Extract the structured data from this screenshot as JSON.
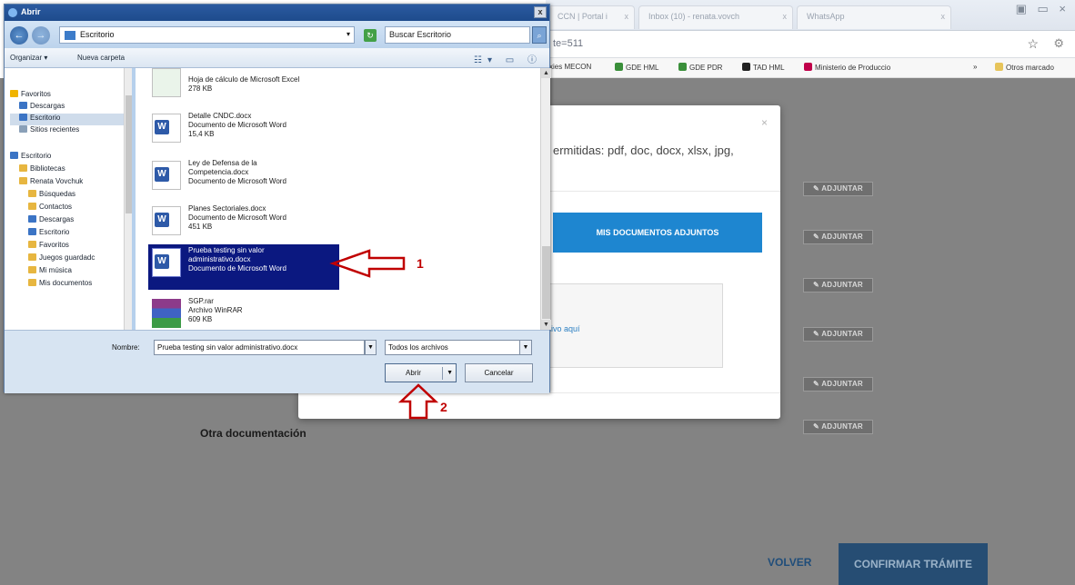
{
  "browser": {
    "tabs": [
      {
        "label": "CCN | Portal i",
        "close": "x"
      },
      {
        "label": "Inbox (10) - renata.vovch",
        "close": "x"
      },
      {
        "label": "WhatsApp",
        "close": "x"
      }
    ],
    "window_buttons": "▣ ▭ ×",
    "url": "te=511",
    "bookmarks": [
      {
        "label": "xies MECON",
        "color": "#ffffff"
      },
      {
        "label": "GDE HML",
        "color": "#3a8f3a"
      },
      {
        "label": "GDE PDR",
        "color": "#3a8f3a"
      },
      {
        "label": "TAD HML",
        "color": "#222222"
      },
      {
        "label": "Ministerio de Produccio",
        "color": "#c0004a"
      }
    ],
    "bookmarks_overflow": "»",
    "other_bookmarks": "Otros marcado"
  },
  "modal": {
    "close": "×",
    "hint": "ermitidas: pdf, doc, docx, xlsx, jpg,",
    "mis_docs_button": "MIS DOCUMENTOS ADJUNTOS",
    "drop_link": "hivo aquí"
  },
  "page": {
    "attach_button_label": "✎ ADJUNTAR",
    "otra_documentacion": "Otra documentación",
    "volver": "VOLVER",
    "confirmar": "CONFIRMAR TRÁMITE"
  },
  "dialog": {
    "title": "Abrir",
    "close": "x",
    "back": "←",
    "forward": "→",
    "location": "Escritorio",
    "search_placeholder": "Buscar Escritorio",
    "toolbar": {
      "organize": "Organizar ▾",
      "new_folder": "Nueva carpeta"
    },
    "nav_items": [
      {
        "label": "Favoritos",
        "icon": "star-icon",
        "color": "#f0b400",
        "selected": false
      },
      {
        "label": "Descargas",
        "icon": "download-folder-icon",
        "color": "#3b74c5",
        "selected": false
      },
      {
        "label": "Escritorio",
        "icon": "desktop-icon",
        "color": "#3b74c5",
        "selected": true
      },
      {
        "label": "Sitios recientes",
        "icon": "recent-icon",
        "color": "#8aa0b8",
        "selected": false
      },
      {
        "label": "Escritorio",
        "icon": "desktop-icon",
        "color": "#3b74c5",
        "selected": false
      },
      {
        "label": "Bibliotecas",
        "icon": "library-icon",
        "color": "#e7b640",
        "selected": false
      },
      {
        "label": "Renata Vovchuk",
        "icon": "user-folder-icon",
        "color": "#e7b640",
        "selected": false
      },
      {
        "label": "Búsquedas",
        "icon": "search-folder-icon",
        "color": "#e7b640",
        "selected": false
      },
      {
        "label": "Contactos",
        "icon": "contacts-icon",
        "color": "#e7b640",
        "selected": false
      },
      {
        "label": "Descargas",
        "icon": "download-folder-icon",
        "color": "#3b74c5",
        "selected": false
      },
      {
        "label": "Escritorio",
        "icon": "desktop-icon",
        "color": "#3b74c5",
        "selected": false
      },
      {
        "label": "Favoritos",
        "icon": "folder-icon",
        "color": "#e7b640",
        "selected": false
      },
      {
        "label": "Juegos guardadc",
        "icon": "games-folder-icon",
        "color": "#e7b640",
        "selected": false
      },
      {
        "label": "Mi música",
        "icon": "music-folder-icon",
        "color": "#e7b640",
        "selected": false
      },
      {
        "label": "Mis documentos",
        "icon": "documents-folder-icon",
        "color": "#e7b640",
        "selected": false
      }
    ],
    "files": [
      {
        "name": "",
        "type": "Hoja de cálculo de Microsoft Excel",
        "size": "278 KB",
        "kind": "excel"
      },
      {
        "name": "Detalle CNDC.docx",
        "type": "Documento de Microsoft Word",
        "size": "15,4 KB",
        "kind": "word"
      },
      {
        "name": "Ley de Defensa de la Competencia.docx",
        "type": "Documento de Microsoft Word",
        "size": "",
        "kind": "word"
      },
      {
        "name": "Planes Sectoriales.docx",
        "type": "Documento de Microsoft Word",
        "size": "451 KB",
        "kind": "word"
      },
      {
        "name": "Prueba testing sin valor administrativo.docx",
        "type": "Documento de Microsoft Word",
        "size": "",
        "kind": "word",
        "selected": true
      },
      {
        "name": "SGP.rar",
        "type": "Archivo WinRAR",
        "size": "609 KB",
        "kind": "rar"
      }
    ],
    "name_label": "Nombre:",
    "name_value": "Prueba testing sin valor administrativo.docx",
    "file_type": "Todos los archivos",
    "open_button": "Abrir",
    "cancel_button": "Cancelar"
  },
  "annotations": {
    "label_1": "1",
    "label_2": "2",
    "color": "#c00000"
  }
}
